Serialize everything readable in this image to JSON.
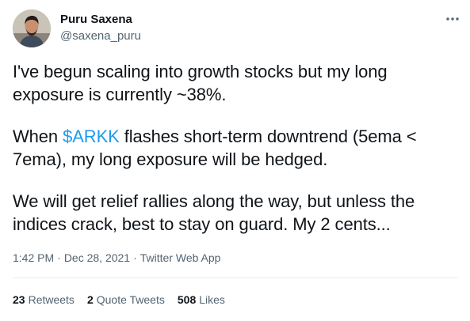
{
  "author": {
    "display_name": "Puru Saxena",
    "handle": "@saxena_puru"
  },
  "tweet": {
    "p1": "I've begun scaling into growth stocks but my long exposure is currently ~38%.",
    "p2_before": "When ",
    "p2_cashtag": "$ARKK",
    "p2_after": " flashes short-term downtrend (5ema < 7ema), my long exposure will be hedged.",
    "p3": "We will get relief rallies along the way, but unless the indices crack, best to stay on guard. My 2 cents..."
  },
  "meta": {
    "time": "1:42 PM",
    "separator": "·",
    "date": "Dec 28, 2021",
    "source": "Twitter Web App"
  },
  "stats": {
    "retweets_count": "23",
    "retweets_label": "Retweets",
    "quotes_count": "2",
    "quotes_label": "Quote Tweets",
    "likes_count": "508",
    "likes_label": "Likes"
  },
  "colors": {
    "link": "#1d9bf0",
    "text": "#0f1419",
    "secondary": "#536471",
    "divider": "#e7e9ea"
  },
  "icons": {
    "more": "more-horizontal-icon"
  }
}
